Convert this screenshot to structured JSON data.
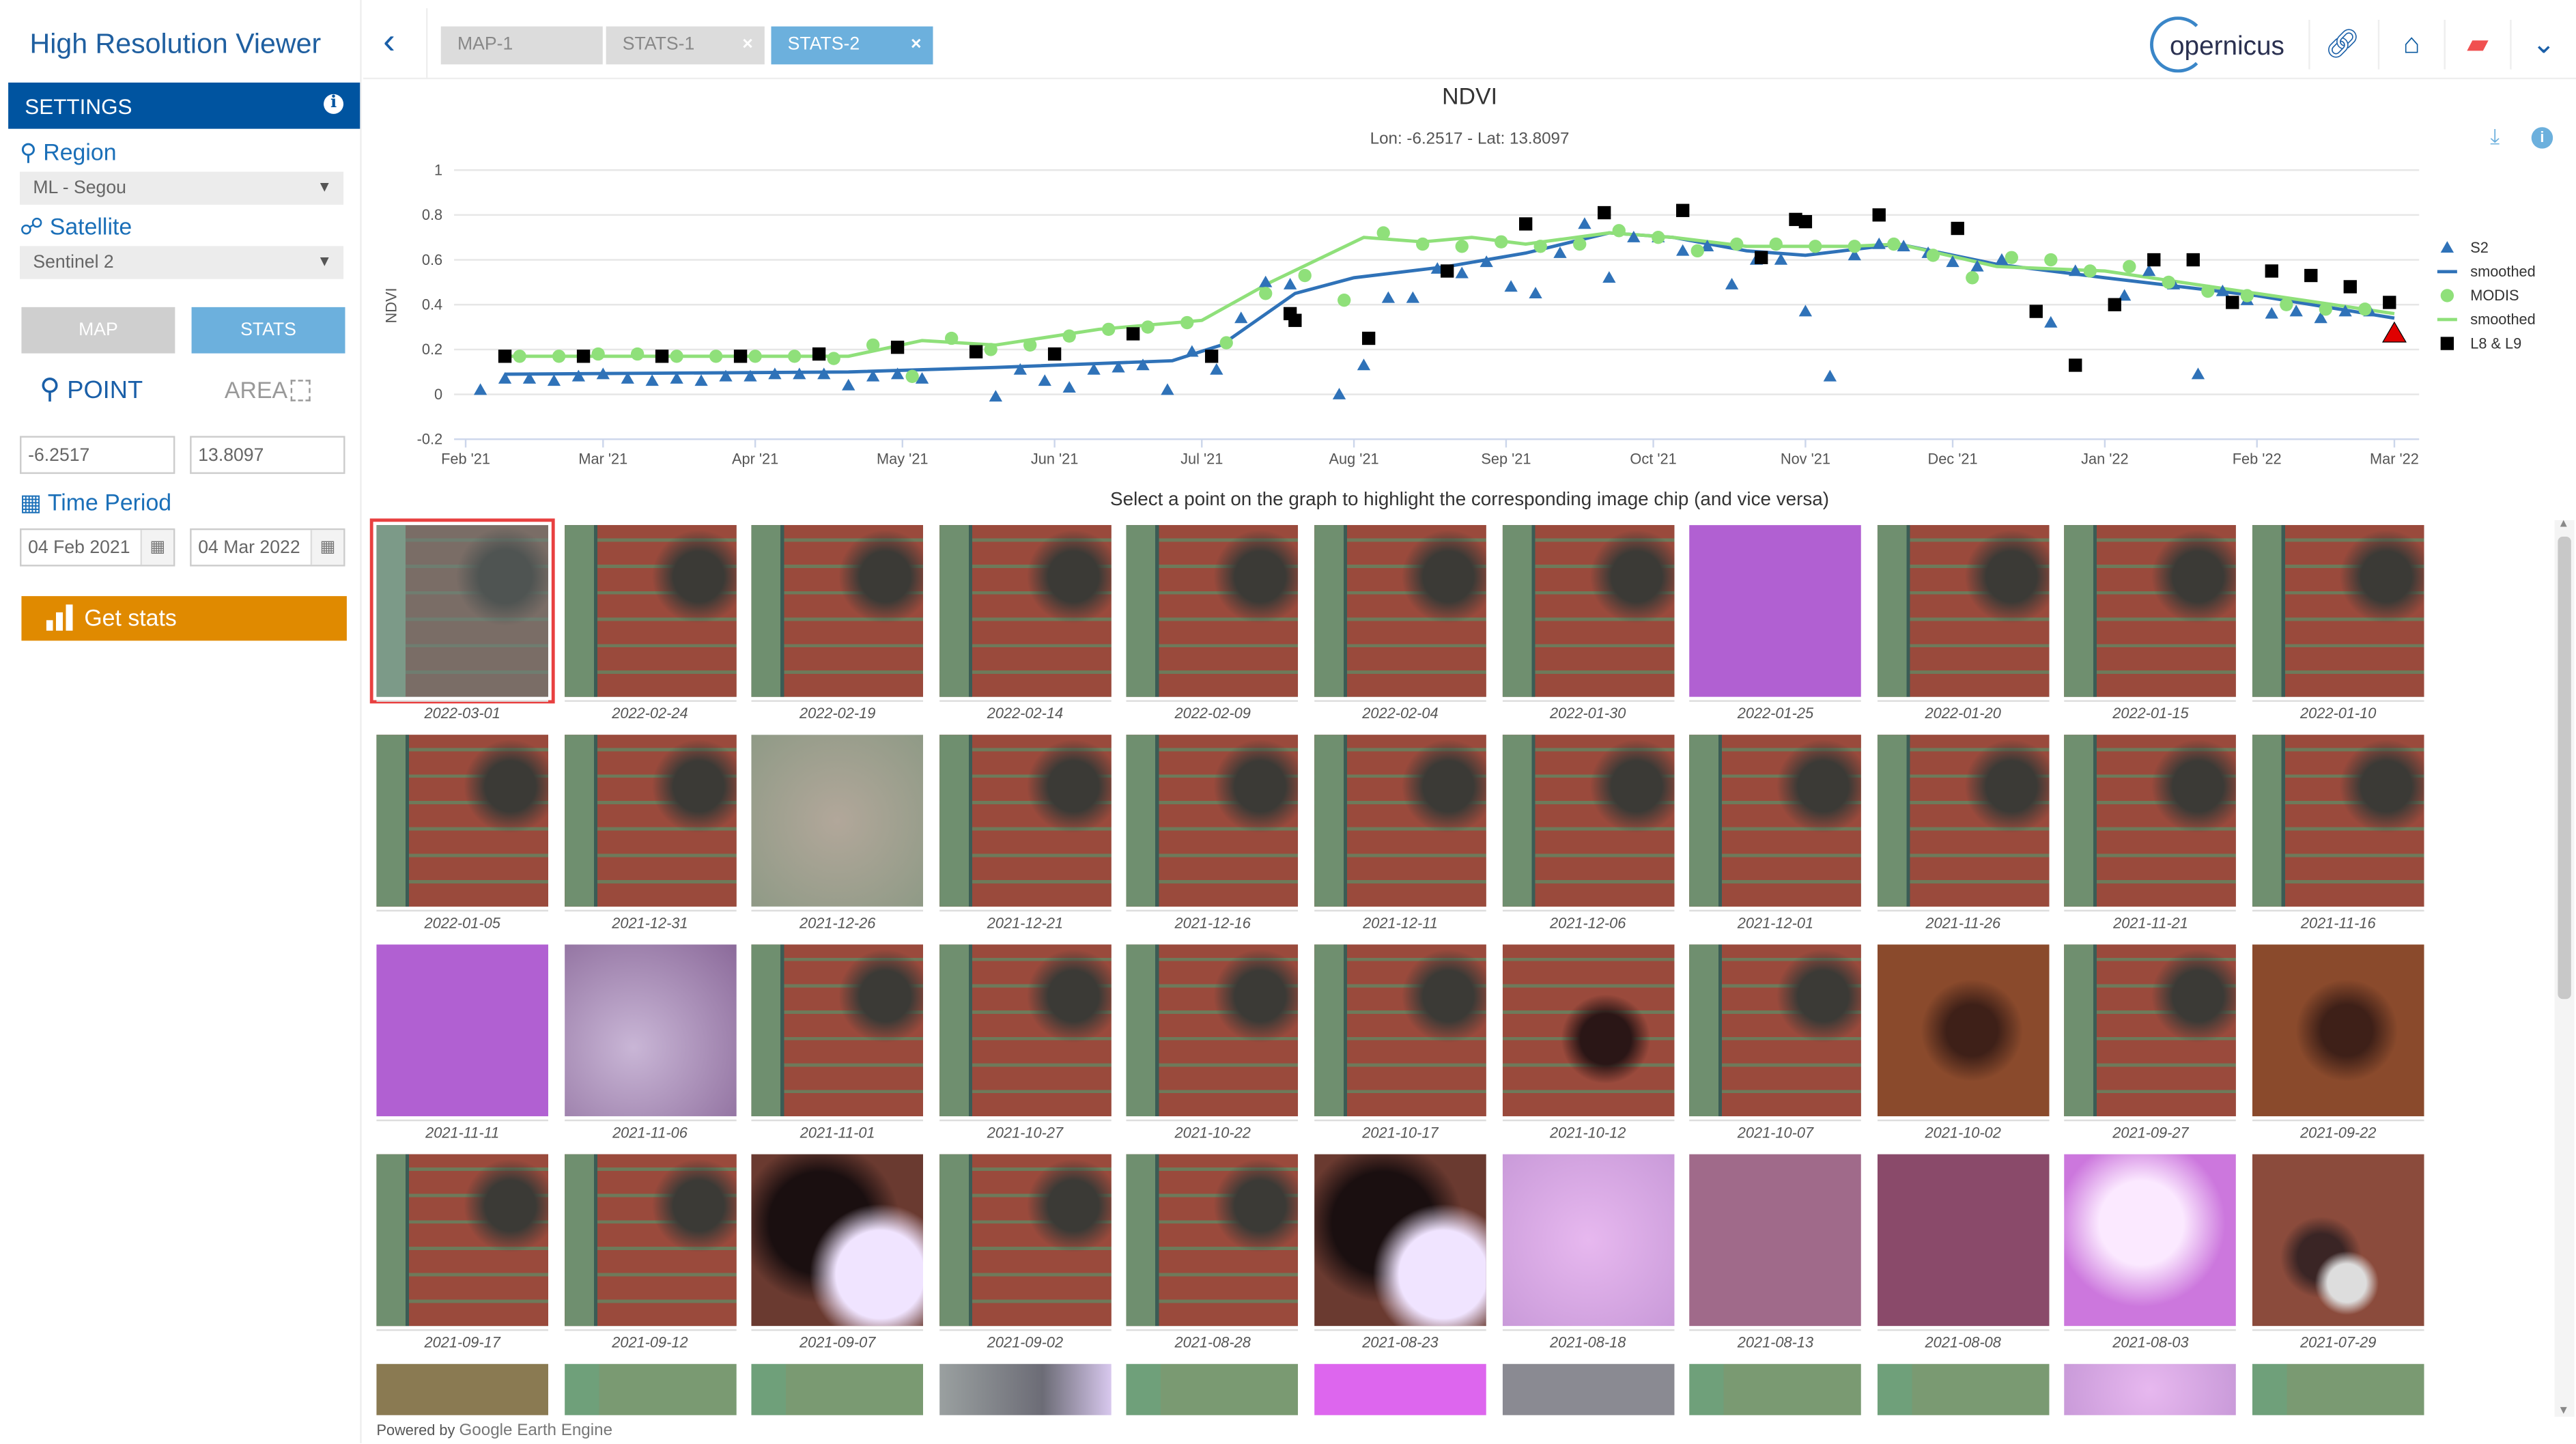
{
  "app": {
    "title": "High Resolution Viewer"
  },
  "tabs": [
    {
      "label": "MAP-1",
      "close": ""
    },
    {
      "label": "STATS-1",
      "close": "×"
    },
    {
      "label": "STATS-2",
      "close": "×"
    }
  ],
  "header": {
    "logo_text": "opernicus",
    "icons": [
      "link-icon",
      "home-icon",
      "book-reader-icon",
      "chevron-down-icon"
    ],
    "back": "‹"
  },
  "sidebar": {
    "settings": "SETTINGS",
    "info": "i",
    "region_label": "Region",
    "region_value": "ML - Segou",
    "satellite_label": "Satellite",
    "satellite_value": "Sentinel 2",
    "map_button": "MAP",
    "stats_button": "STATS",
    "point": "POINT",
    "area": "AREA",
    "lon": "-6.2517",
    "lat": "13.8097",
    "time_label": "Time Period",
    "date_from": "04 Feb 2021",
    "date_to": "04 Mar 2022",
    "get_stats": "Get stats"
  },
  "caption": "Select a point on the graph to highlight the corresponding image chip (and vice versa)",
  "footer": {
    "powered": "Powered by",
    "gee": "Google Earth Engine"
  },
  "colors": {
    "brand": "#0054a0",
    "accent": "#6cb0dd",
    "orange": "#e08a00",
    "s2": "#2f72b8",
    "modis": "#8fe07a",
    "l8": "#000000",
    "selected": "#e00000"
  },
  "thumbs": [
    "2022-03-01",
    "2022-02-24",
    "2022-02-19",
    "2022-02-14",
    "2022-02-09",
    "2022-02-04",
    "2022-01-30",
    "2022-01-25",
    "2022-01-20",
    "2022-01-15",
    "2022-01-10",
    "2022-01-05",
    "2021-12-31",
    "2021-12-26",
    "2021-12-21",
    "2021-12-16",
    "2021-12-11",
    "2021-12-06",
    "2021-12-01",
    "2021-11-26",
    "2021-11-21",
    "2021-11-16",
    "2021-11-11",
    "2021-11-06",
    "2021-11-01",
    "2021-10-27",
    "2021-10-22",
    "2021-10-17",
    "2021-10-12",
    "2021-10-07",
    "2021-10-02",
    "2021-09-27",
    "2021-09-22",
    "2021-09-17",
    "2021-09-12",
    "2021-09-07",
    "2021-09-02",
    "2021-08-28",
    "2021-08-23",
    "2021-08-18",
    "2021-08-13",
    "2021-08-08",
    "2021-08-03",
    "2021-07-29"
  ],
  "chart_data": {
    "type": "scatter",
    "title": "NDVI",
    "subtitle": "Lon: -6.2517 - Lat: 13.8097",
    "ylabel": "NDVI",
    "ylim": [
      -0.2,
      1
    ],
    "yticks": [
      "1",
      "0.8",
      "0.6",
      "0.4",
      "0.2",
      "0",
      "-0.2"
    ],
    "xlim": [
      "2021-02-01",
      "2022-03-01"
    ],
    "xticks": [
      [
        "2021-02-01",
        "Feb '21"
      ],
      [
        "2021-03-01",
        "Mar '21"
      ],
      [
        "2021-04-01",
        "Apr '21"
      ],
      [
        "2021-05-01",
        "May '21"
      ],
      [
        "2021-06-01",
        "Jun '21"
      ],
      [
        "2021-07-01",
        "Jul '21"
      ],
      [
        "2021-08-01",
        "Aug '21"
      ],
      [
        "2021-09-01",
        "Sep '21"
      ],
      [
        "2021-10-01",
        "Oct '21"
      ],
      [
        "2021-11-01",
        "Nov '21"
      ],
      [
        "2021-12-01",
        "Dec '21"
      ],
      [
        "2022-01-01",
        "Jan '22"
      ],
      [
        "2022-02-01",
        "Feb '22"
      ],
      [
        "2022-03-01",
        "Mar '22"
      ]
    ],
    "legend_position": "right",
    "series": [
      {
        "name": "S2",
        "kind": "triangle",
        "color": "#2f72b8",
        "points": [
          [
            "2021-02-04",
            0.02
          ],
          [
            "2021-02-09",
            0.07
          ],
          [
            "2021-02-14",
            0.07
          ],
          [
            "2021-02-19",
            0.06
          ],
          [
            "2021-02-24",
            0.08
          ],
          [
            "2021-03-01",
            0.09
          ],
          [
            "2021-03-06",
            0.07
          ],
          [
            "2021-03-11",
            0.06
          ],
          [
            "2021-03-16",
            0.07
          ],
          [
            "2021-03-21",
            0.06
          ],
          [
            "2021-03-26",
            0.08
          ],
          [
            "2021-03-31",
            0.08
          ],
          [
            "2021-04-05",
            0.09
          ],
          [
            "2021-04-10",
            0.09
          ],
          [
            "2021-04-15",
            0.09
          ],
          [
            "2021-04-20",
            0.04
          ],
          [
            "2021-04-25",
            0.08
          ],
          [
            "2021-04-30",
            0.09
          ],
          [
            "2021-05-05",
            0.07
          ],
          [
            "2021-05-20",
            -0.01
          ],
          [
            "2021-05-25",
            0.11
          ],
          [
            "2021-05-30",
            0.06
          ],
          [
            "2021-06-04",
            0.03
          ],
          [
            "2021-06-09",
            0.11
          ],
          [
            "2021-06-14",
            0.12
          ],
          [
            "2021-06-19",
            0.13
          ],
          [
            "2021-06-24",
            0.02
          ],
          [
            "2021-06-29",
            0.19
          ],
          [
            "2021-07-04",
            0.11
          ],
          [
            "2021-07-09",
            0.34
          ],
          [
            "2021-07-14",
            0.5
          ],
          [
            "2021-07-19",
            0.49
          ],
          [
            "2021-07-29",
            0.0
          ],
          [
            "2021-08-03",
            0.13
          ],
          [
            "2021-08-08",
            0.43
          ],
          [
            "2021-08-13",
            0.43
          ],
          [
            "2021-08-18",
            0.56
          ],
          [
            "2021-08-23",
            0.54
          ],
          [
            "2021-08-28",
            0.59
          ],
          [
            "2021-09-02",
            0.48
          ],
          [
            "2021-09-07",
            0.45
          ],
          [
            "2021-09-12",
            0.63
          ],
          [
            "2021-09-17",
            0.76
          ],
          [
            "2021-09-22",
            0.52
          ],
          [
            "2021-09-27",
            0.7
          ],
          [
            "2021-10-02",
            0.7
          ],
          [
            "2021-10-07",
            0.64
          ],
          [
            "2021-10-12",
            0.66
          ],
          [
            "2021-10-17",
            0.49
          ],
          [
            "2021-10-22",
            0.6
          ],
          [
            "2021-10-27",
            0.6
          ],
          [
            "2021-11-01",
            0.37
          ],
          [
            "2021-11-06",
            0.08
          ],
          [
            "2021-11-11",
            0.62
          ],
          [
            "2021-11-16",
            0.67
          ],
          [
            "2021-11-21",
            0.66
          ],
          [
            "2021-11-26",
            0.63
          ],
          [
            "2021-12-01",
            0.59
          ],
          [
            "2021-12-06",
            0.57
          ],
          [
            "2021-12-11",
            0.6
          ],
          [
            "2021-12-21",
            0.32
          ],
          [
            "2021-12-26",
            0.55
          ],
          [
            "2022-01-05",
            0.44
          ],
          [
            "2022-01-10",
            0.55
          ],
          [
            "2022-01-15",
            0.49
          ],
          [
            "2022-01-20",
            0.09
          ],
          [
            "2022-01-25",
            0.46
          ],
          [
            "2022-01-30",
            0.42
          ],
          [
            "2022-02-04",
            0.36
          ],
          [
            "2022-02-09",
            0.37
          ],
          [
            "2022-02-14",
            0.34
          ],
          [
            "2022-02-19",
            0.37
          ],
          [
            "2022-02-24",
            0.37
          ]
        ]
      },
      {
        "name": "smoothed",
        "kind": "line",
        "color": "#2f72b8",
        "points": [
          [
            "2021-02-09",
            0.09
          ],
          [
            "2021-04-20",
            0.1
          ],
          [
            "2021-05-20",
            0.12
          ],
          [
            "2021-06-25",
            0.15
          ],
          [
            "2021-07-05",
            0.22
          ],
          [
            "2021-07-20",
            0.45
          ],
          [
            "2021-08-01",
            0.52
          ],
          [
            "2021-08-20",
            0.57
          ],
          [
            "2021-09-05",
            0.63
          ],
          [
            "2021-09-22",
            0.72
          ],
          [
            "2021-10-05",
            0.7
          ],
          [
            "2021-10-20",
            0.64
          ],
          [
            "2021-11-01",
            0.62
          ],
          [
            "2021-11-20",
            0.67
          ],
          [
            "2021-12-10",
            0.58
          ],
          [
            "2022-01-01",
            0.52
          ],
          [
            "2022-02-01",
            0.44
          ],
          [
            "2022-03-01",
            0.34
          ]
        ]
      },
      {
        "name": "MODIS",
        "kind": "circle",
        "color": "#8fe07a",
        "points": [
          [
            "2021-02-12",
            0.17
          ],
          [
            "2021-02-20",
            0.17
          ],
          [
            "2021-02-28",
            0.18
          ],
          [
            "2021-03-08",
            0.18
          ],
          [
            "2021-03-16",
            0.17
          ],
          [
            "2021-03-24",
            0.17
          ],
          [
            "2021-04-01",
            0.17
          ],
          [
            "2021-04-09",
            0.17
          ],
          [
            "2021-04-17",
            0.16
          ],
          [
            "2021-04-25",
            0.22
          ],
          [
            "2021-05-03",
            0.08
          ],
          [
            "2021-05-11",
            0.25
          ],
          [
            "2021-05-19",
            0.2
          ],
          [
            "2021-05-27",
            0.22
          ],
          [
            "2021-06-04",
            0.26
          ],
          [
            "2021-06-12",
            0.29
          ],
          [
            "2021-06-20",
            0.3
          ],
          [
            "2021-06-28",
            0.32
          ],
          [
            "2021-07-06",
            0.23
          ],
          [
            "2021-07-14",
            0.45
          ],
          [
            "2021-07-22",
            0.53
          ],
          [
            "2021-07-30",
            0.42
          ],
          [
            "2021-08-07",
            0.72
          ],
          [
            "2021-08-15",
            0.67
          ],
          [
            "2021-08-23",
            0.66
          ],
          [
            "2021-08-31",
            0.68
          ],
          [
            "2021-09-08",
            0.66
          ],
          [
            "2021-09-16",
            0.67
          ],
          [
            "2021-09-24",
            0.73
          ],
          [
            "2021-10-02",
            0.7
          ],
          [
            "2021-10-10",
            0.64
          ],
          [
            "2021-10-18",
            0.67
          ],
          [
            "2021-10-26",
            0.67
          ],
          [
            "2021-11-03",
            0.66
          ],
          [
            "2021-11-11",
            0.66
          ],
          [
            "2021-11-19",
            0.67
          ],
          [
            "2021-11-27",
            0.62
          ],
          [
            "2021-12-05",
            0.52
          ],
          [
            "2021-12-13",
            0.61
          ],
          [
            "2021-12-21",
            0.6
          ],
          [
            "2021-12-29",
            0.55
          ],
          [
            "2022-01-06",
            0.57
          ],
          [
            "2022-01-14",
            0.5
          ],
          [
            "2022-01-22",
            0.46
          ],
          [
            "2022-01-30",
            0.44
          ],
          [
            "2022-02-07",
            0.4
          ],
          [
            "2022-02-15",
            0.38
          ],
          [
            "2022-02-23",
            0.38
          ]
        ]
      },
      {
        "name": "smoothed",
        "kind": "line",
        "color": "#8fe07a",
        "points": [
          [
            "2021-02-09",
            0.17
          ],
          [
            "2021-04-20",
            0.17
          ],
          [
            "2021-05-05",
            0.24
          ],
          [
            "2021-05-20",
            0.22
          ],
          [
            "2021-06-10",
            0.29
          ],
          [
            "2021-07-01",
            0.33
          ],
          [
            "2021-07-15",
            0.5
          ],
          [
            "2021-08-03",
            0.7
          ],
          [
            "2021-08-15",
            0.68
          ],
          [
            "2021-08-25",
            0.7
          ],
          [
            "2021-09-05",
            0.67
          ],
          [
            "2021-09-22",
            0.72
          ],
          [
            "2021-10-05",
            0.7
          ],
          [
            "2021-10-20",
            0.66
          ],
          [
            "2021-11-10",
            0.66
          ],
          [
            "2021-11-20",
            0.67
          ],
          [
            "2021-12-10",
            0.57
          ],
          [
            "2022-01-01",
            0.55
          ],
          [
            "2022-02-01",
            0.45
          ],
          [
            "2022-03-01",
            0.36
          ]
        ]
      },
      {
        "name": "L8 & L9",
        "kind": "square",
        "color": "#000000",
        "points": [
          [
            "2021-02-09",
            0.17
          ],
          [
            "2021-02-25",
            0.17
          ],
          [
            "2021-03-13",
            0.17
          ],
          [
            "2021-03-29",
            0.17
          ],
          [
            "2021-04-14",
            0.18
          ],
          [
            "2021-04-30",
            0.21
          ],
          [
            "2021-05-16",
            0.19
          ],
          [
            "2021-06-01",
            0.18
          ],
          [
            "2021-06-17",
            0.27
          ],
          [
            "2021-07-03",
            0.17
          ],
          [
            "2021-07-19",
            0.36
          ],
          [
            "2021-07-20",
            0.33
          ],
          [
            "2021-08-04",
            0.25
          ],
          [
            "2021-08-20",
            0.55
          ],
          [
            "2021-09-05",
            0.76
          ],
          [
            "2021-09-21",
            0.81
          ],
          [
            "2021-10-07",
            0.82
          ],
          [
            "2021-10-23",
            0.61
          ],
          [
            "2021-10-30",
            0.78
          ],
          [
            "2021-11-01",
            0.77
          ],
          [
            "2021-11-16",
            0.8
          ],
          [
            "2021-12-02",
            0.74
          ],
          [
            "2021-12-18",
            0.37
          ],
          [
            "2021-12-26",
            0.13
          ],
          [
            "2022-01-03",
            0.4
          ],
          [
            "2022-01-11",
            0.6
          ],
          [
            "2022-01-19",
            0.6
          ],
          [
            "2022-01-27",
            0.41
          ],
          [
            "2022-02-04",
            0.55
          ],
          [
            "2022-02-12",
            0.53
          ],
          [
            "2022-02-20",
            0.48
          ],
          [
            "2022-02-28",
            0.41
          ]
        ]
      }
    ],
    "highlighted": {
      "date": "2022-03-01",
      "value": 0.27,
      "color": "#e00000"
    }
  }
}
